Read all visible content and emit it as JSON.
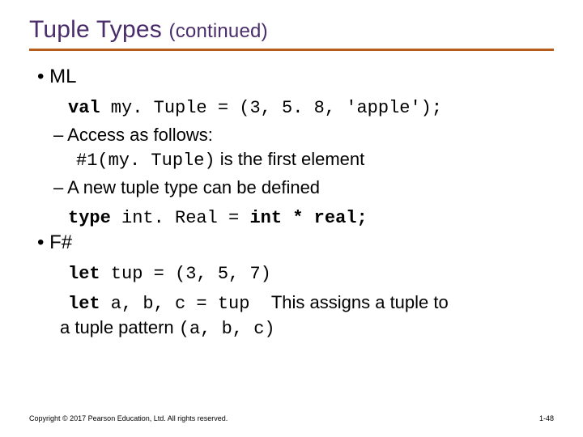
{
  "title_main": "Tuple Types ",
  "title_cont": "(continued)",
  "bullets": {
    "ml": "ML",
    "ml_code": "val my. Tuple = (3, 5. 8, ′apple′);",
    "access": "Access as follows:",
    "access_code": "#1(my. Tuple)",
    "access_text": " is the first element",
    "newtype": "A new tuple type can be defined",
    "newtype_code": "type int. Real = int * real;",
    "fsharp": "F#",
    "fs_code1": "let tup = (3, 5, 7)",
    "fs_code2": "let a, b, c = tup  ",
    "fs_text1": "This assigns a tuple to a tuple pattern ",
    "fs_code3": "(a, b, c)"
  },
  "footer": {
    "copyright": "Copyright © 2017 Pearson Education, Ltd. All rights reserved.",
    "page": "1-48"
  }
}
